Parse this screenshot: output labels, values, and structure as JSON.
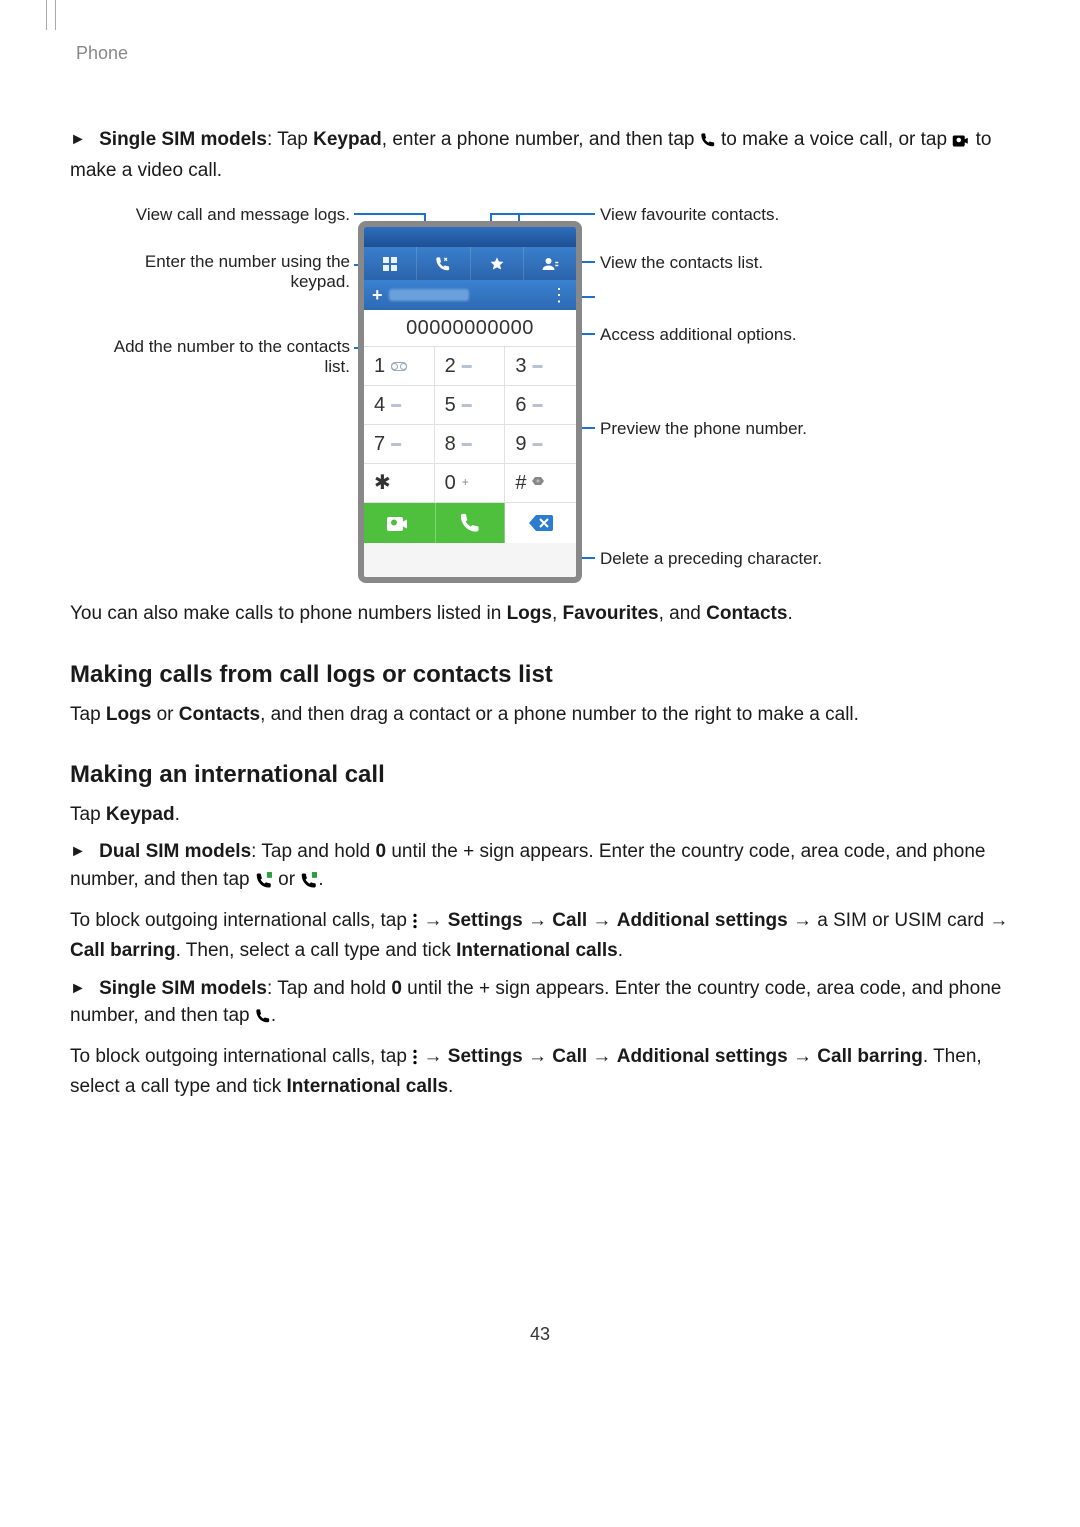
{
  "header": {
    "section": "Phone"
  },
  "intro": {
    "bullet_label": "Single SIM models",
    "sentence_a": ": Tap ",
    "keypad_word": "Keypad",
    "sentence_b": ", enter a phone number, and then tap ",
    "sentence_c": " to make a voice call, or tap ",
    "sentence_d": " to make a video call."
  },
  "diagram": {
    "left": {
      "logs": "View call and message logs.",
      "enter_keypad_a": "Enter the number using the",
      "enter_keypad_b": "keypad.",
      "add_contact_a": "Add the number to the contacts",
      "add_contact_b": "list."
    },
    "right": {
      "fav": "View favourite contacts.",
      "contacts": "View the contacts list.",
      "options": "Access additional options.",
      "preview": "Preview the phone number.",
      "delete": "Delete a preceding character."
    },
    "phone": {
      "number_display": "00000000000",
      "keys": [
        {
          "d": "1",
          "sub": "vm"
        },
        {
          "d": "2",
          "sub": "▬"
        },
        {
          "d": "3",
          "sub": "▬"
        },
        {
          "d": "4",
          "sub": "▬"
        },
        {
          "d": "5",
          "sub": "▬"
        },
        {
          "d": "6",
          "sub": "▬"
        },
        {
          "d": "7",
          "sub": "▬"
        },
        {
          "d": "8",
          "sub": "▬"
        },
        {
          "d": "9",
          "sub": "▬"
        },
        {
          "d": "✱",
          "sub": ""
        },
        {
          "d": "0",
          "sub": "+"
        },
        {
          "d": "#",
          "sub": "⋈"
        }
      ]
    }
  },
  "after_diagram": {
    "sentence_a": "You can also make calls to phone numbers listed in ",
    "logs": "Logs",
    "sep1": ", ",
    "favourites": "Favourites",
    "sep2": ", and ",
    "contacts": "Contacts",
    "sentence_end": "."
  },
  "section_logs": {
    "heading": "Making calls from call logs or contacts list",
    "sentence_a": "Tap ",
    "logs": "Logs",
    "or": " or ",
    "contacts": "Contacts",
    "sentence_b": ", and then drag a contact or a phone number to the right to make a call."
  },
  "section_intl": {
    "heading": "Making an international call",
    "tap_keypad_a": "Tap ",
    "tap_keypad_b": "Keypad",
    "tap_keypad_c": ".",
    "dual": {
      "label": "Dual SIM models",
      "a": ": Tap and hold ",
      "zero": "0",
      "b": " until the + sign appears. Enter the country code, area code, and phone number, and then tap ",
      "or": " or ",
      "end": "."
    },
    "block1": {
      "a": "To block outgoing international calls, tap ",
      "arrow1": " → ",
      "settings": "Settings",
      "arrow2": " → ",
      "call": "Call",
      "arrow3": " → ",
      "additional": "Additional settings",
      "arrow4": " → a SIM or USIM card → ",
      "call_barring": "Call barring",
      "c": ". Then, select a call type and tick ",
      "intl": "International calls",
      "end": "."
    },
    "single": {
      "label": "Single SIM models",
      "a": ": Tap and hold ",
      "zero": "0",
      "b": " until the + sign appears. Enter the country code, area code, and phone number, and then tap ",
      "end": "."
    },
    "block2": {
      "a": "To block outgoing international calls, tap ",
      "arrow1": " → ",
      "settings": "Settings",
      "arrow2": " → ",
      "call": "Call",
      "arrow3": " → ",
      "additional": "Additional settings",
      "arrow4": " → ",
      "call_barring": "Call barring",
      "c": ". Then, select a call type and tick ",
      "intl": "International calls",
      "end": "."
    }
  },
  "page_number": "43"
}
